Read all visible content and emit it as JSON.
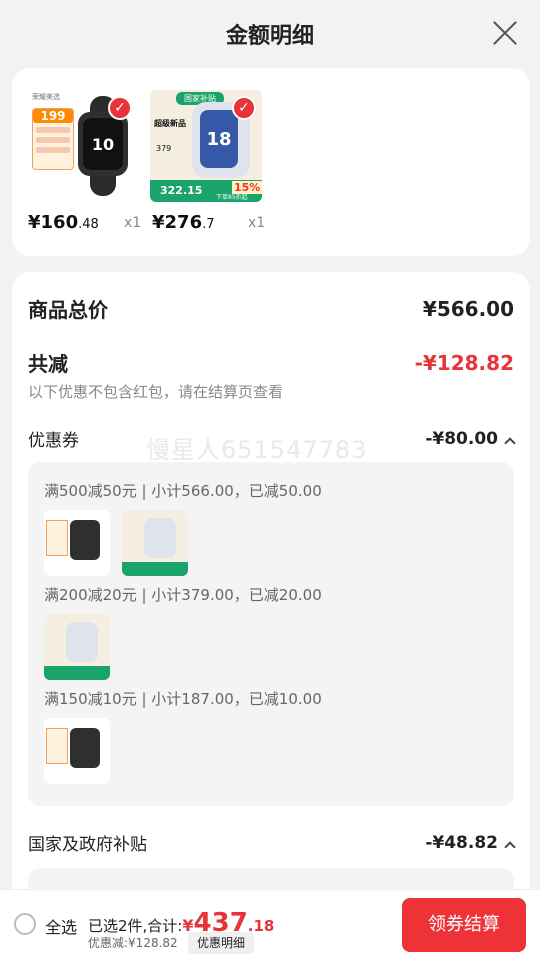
{
  "header": {
    "title": "金额明细"
  },
  "products": [
    {
      "price_int": "¥160",
      "price_dec": ".48",
      "qty": "x1"
    },
    {
      "price_int": "¥276",
      "price_dec": ".7",
      "qty": "x1"
    }
  ],
  "thumb_text": {
    "brand": "荣耀美选",
    "price_badge": "199",
    "screen_1": "10",
    "gov_tag": "国家补贴",
    "super_new": "超级新品",
    "screen_2": "18",
    "price_small": "379",
    "sub_price": "322.15",
    "percent": "15%",
    "discount_note": "下单85折起"
  },
  "summary": {
    "total_label": "商品总价",
    "total_value": "¥566.00",
    "reduce_label": "共减",
    "reduce_value": "-¥128.82",
    "note": "以下优惠不包含红包，请在结算页查看"
  },
  "coupon": {
    "label": "优惠券",
    "value": "-¥80.00",
    "watermark": "慢星人651547783",
    "tiers": [
      {
        "text": "满500减50元 | 小计566.00，已减50.00"
      },
      {
        "text": "满200减20元 | 小计379.00，已减20.00"
      },
      {
        "text": "满150减10元 | 小计187.00，已减10.00"
      }
    ]
  },
  "subsidy": {
    "label": "国家及政府补贴",
    "value": "-¥48.82"
  },
  "bottom": {
    "select_all": "全选",
    "selected_text": "已选2件,合计:",
    "currency": "¥",
    "total_int": "437",
    "total_dec": ".18",
    "discount_text": "优惠减:¥128.82",
    "detail_button": "优惠明细",
    "checkout_button": "领券结算"
  },
  "colors": {
    "accent": "#e8333a",
    "background": "#f2f2f2",
    "card": "#ffffff"
  }
}
